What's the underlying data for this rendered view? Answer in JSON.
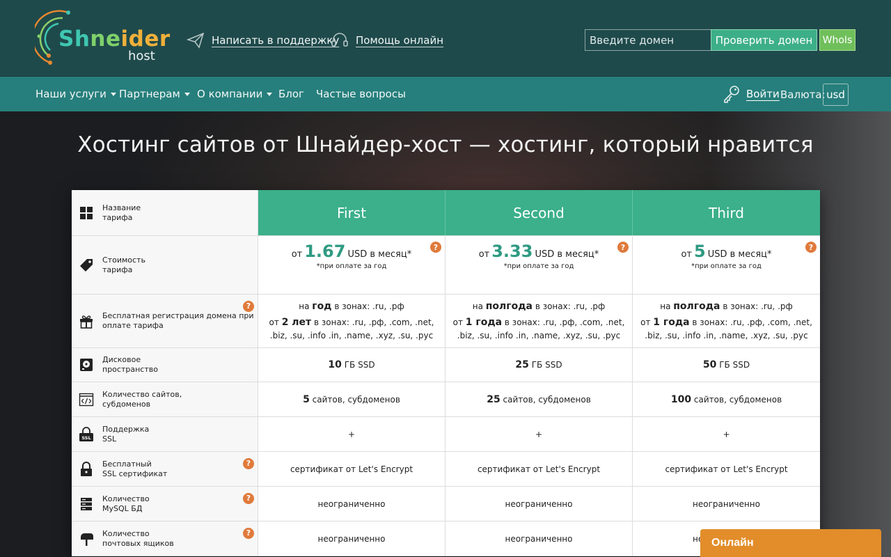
{
  "header": {
    "logo_main": [
      "Sh",
      "ne",
      "ider"
    ],
    "logo_sub": "host",
    "support_link": "Написать в поддержку",
    "help_link": "Помощь онлайн",
    "domain_placeholder": "Введите домен",
    "check_button": "Проверить домен",
    "whois_button": "WhoIs"
  },
  "nav": {
    "items": [
      {
        "label": "Наши услуги",
        "dropdown": true
      },
      {
        "label": "Партнерам",
        "dropdown": true
      },
      {
        "label": "О компании",
        "dropdown": true
      },
      {
        "label": "Блог",
        "dropdown": false
      },
      {
        "label": "Частые вопросы",
        "dropdown": false
      }
    ],
    "login": "Войти",
    "currency_label": "Валюта:",
    "currency_value": "usd"
  },
  "page_title": "Хостинг сайтов от Шнайдер-хост — хостинг, который нравится",
  "table": {
    "plans": [
      "First",
      "Second",
      "Third"
    ],
    "rows": {
      "name": {
        "label": "Название\nтарифа",
        "icon": "grid-icon"
      },
      "price": {
        "label": "Стоимость\nтарифа",
        "icon": "tag-icon",
        "prefix": "от",
        "currency_text": "USD в месяц*",
        "note": "*при оплате за год",
        "values": [
          "1.67",
          "3.33",
          "5"
        ]
      },
      "domain": {
        "label": "Бесплатная регистрация домена при\nоплате тарифа",
        "icon": "gift-icon",
        "line1_prefix": "на",
        "line1_terms": [
          "год",
          "полгода",
          "полгода"
        ],
        "line1_suffix": "в зонах: .ru, .рф",
        "line2_prefix": "от",
        "line2_terms": [
          "2 лет",
          "1 года",
          "1 года"
        ],
        "line2_suffix": "в зонах: .ru, .рф, .com, .net, .biz, .su,",
        "line3": ".info .in, .name, .xyz, .su, .рус"
      },
      "disk": {
        "label": "Дисковое\nпространство",
        "icon": "disk-icon",
        "values": [
          "10",
          "25",
          "50"
        ],
        "unit": "ГБ SSD"
      },
      "sites": {
        "label": "Количество сайтов,\nсубдоменов",
        "icon": "code-icon",
        "values": [
          "5",
          "25",
          "100"
        ],
        "unit": "сайтов, субдоменов"
      },
      "ssl_support": {
        "label": "Поддержка\nSSL",
        "icon": "ssl-icon",
        "values": [
          "+",
          "+",
          "+"
        ]
      },
      "free_ssl": {
        "label": "Бесплатный\nSSL сертификат",
        "icon": "lock-icon",
        "values": [
          "сертификат от Let's Encrypt",
          "сертификат от Let's Encrypt",
          "сертификат от Let's Encrypt"
        ]
      },
      "mysql": {
        "label": "Количество\nMySQL БД",
        "icon": "database-icon",
        "values": [
          "неограниченно",
          "неограниченно",
          "неограниченно"
        ]
      },
      "mail": {
        "label": "Количество\nпочтовых ящиков",
        "icon": "mailbox-icon",
        "values": [
          "неограниченно",
          "неограниченно",
          "неограниченно"
        ]
      }
    },
    "help_mark": "?"
  },
  "chat": {
    "label": "Онлайн"
  },
  "colors": {
    "header_bg": "#1f4a4b",
    "nav_bg": "#267f7c",
    "plan_head": "#3bb08a",
    "accent_orange": "#e07a3b",
    "chat_bg": "#e28d2a"
  }
}
